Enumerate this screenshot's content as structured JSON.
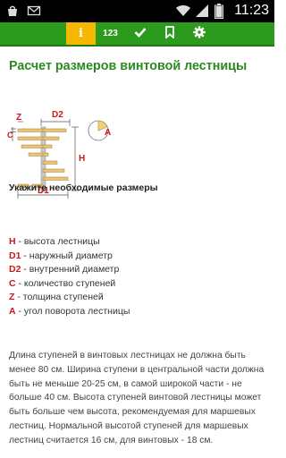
{
  "status_bar": {
    "time": "11:23",
    "icons": [
      "bag-icon",
      "mail-icon",
      "wifi-icon",
      "signal-icon",
      "battery-icon"
    ]
  },
  "toolbar": {
    "tabs": [
      {
        "icon": "info-icon",
        "label": "i",
        "active": true
      },
      {
        "icon": "numbers-icon",
        "label": "123",
        "active": false
      },
      {
        "icon": "check-icon",
        "label": "",
        "active": false
      },
      {
        "icon": "bookmark-icon",
        "label": "",
        "active": false
      },
      {
        "icon": "gear-icon",
        "label": "",
        "active": false
      }
    ],
    "colors": {
      "bar": "#2c9a1d",
      "active_tab": "#f4b800"
    }
  },
  "page": {
    "title": "Расчет размеров винтовой лестницы",
    "title_color": "#2b8a1f"
  },
  "diagram": {
    "labels": {
      "z": "Z",
      "d2": "D2",
      "h": "H",
      "d1": "D1",
      "c": "C",
      "a": "A"
    },
    "label_color": "#d0161b"
  },
  "instructions": {
    "heading": "Укажите необходимые размеры",
    "legend": [
      {
        "symbol": "H",
        "text": " - высота лестницы"
      },
      {
        "symbol": "D1",
        "text": " - наружный диаметр"
      },
      {
        "symbol": "D2",
        "text": " - внутренний диаметр"
      },
      {
        "symbol": "C",
        "text": " - количество ступеней"
      },
      {
        "symbol": "Z",
        "text": " - толщина ступеней"
      },
      {
        "symbol": "A",
        "text": " - угол поворота лестницы"
      }
    ]
  },
  "description": {
    "text": "Длина ступеней в винтовых лестницах не должна быть менее 80 см. Ширина ступени в центральной части должна быть не меньше 20-25 см, в самой широкой части - не больше 40 см. Высота ступеней винтовой лестницы может быть больше чем высота, рекомендуемая для маршевых лестниц. Нормальной высотой ступеней для маршевых лестниц считается 16 см, для винтовых - 18 см."
  }
}
